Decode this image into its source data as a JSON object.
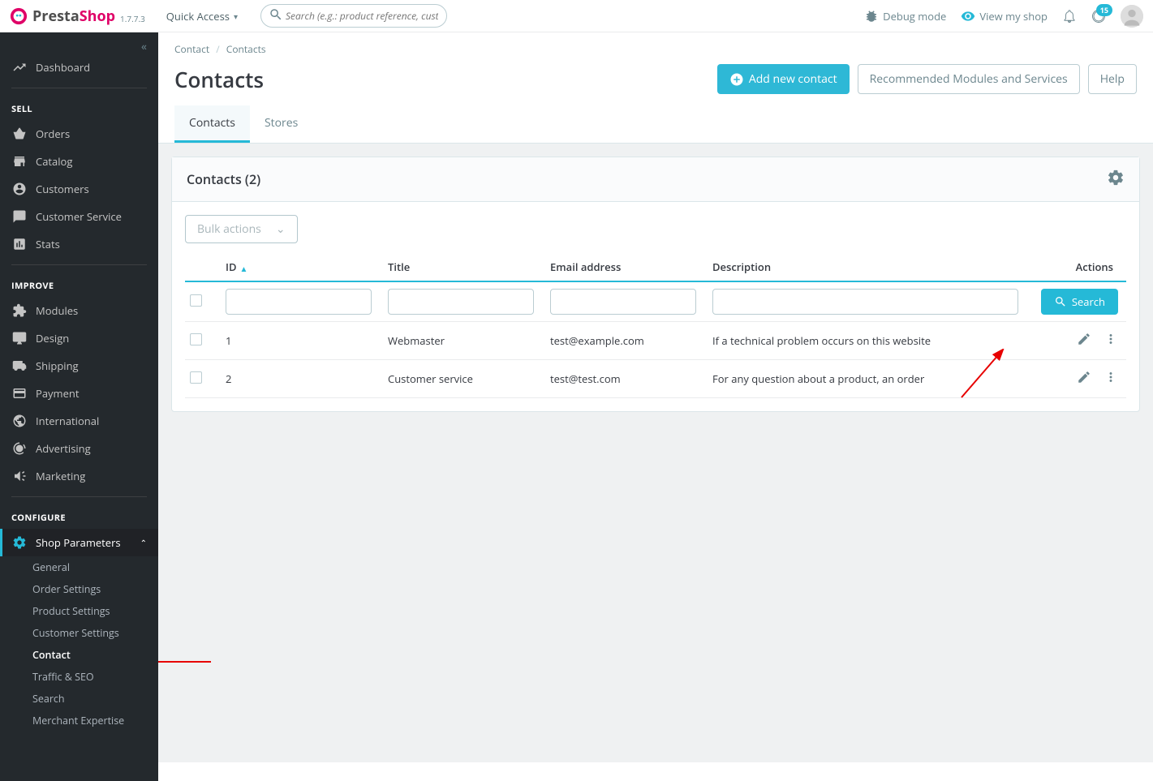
{
  "header": {
    "brand1": "Presta",
    "brand2": "Shop",
    "version": "1.7.7.3",
    "quick_access": "Quick Access",
    "search_placeholder": "Search (e.g.: product reference, customer name…)",
    "debug": "Debug mode",
    "view_shop": "View my shop",
    "notif_count": "15"
  },
  "sidebar": {
    "dashboard": "Dashboard",
    "sell": "SELL",
    "orders": "Orders",
    "catalog": "Catalog",
    "customers": "Customers",
    "customer_service": "Customer Service",
    "stats": "Stats",
    "improve": "IMPROVE",
    "modules": "Modules",
    "design": "Design",
    "shipping": "Shipping",
    "payment": "Payment",
    "international": "International",
    "advertising": "Advertising",
    "marketing": "Marketing",
    "configure": "CONFIGURE",
    "shop_parameters": "Shop Parameters",
    "sub": {
      "general": "General",
      "order_settings": "Order Settings",
      "product_settings": "Product Settings",
      "customer_settings": "Customer Settings",
      "contact": "Contact",
      "traffic_seo": "Traffic & SEO",
      "search": "Search",
      "merchant_expertise": "Merchant Expertise"
    }
  },
  "breadcrumb": {
    "parent": "Contact",
    "current": "Contacts"
  },
  "page": {
    "title": "Contacts",
    "add_btn": "Add new contact",
    "rec_modules": "Recommended Modules and Services",
    "help": "Help"
  },
  "tabs": {
    "contacts": "Contacts",
    "stores": "Stores"
  },
  "card": {
    "title": "Contacts (2)",
    "bulk": "Bulk actions"
  },
  "columns": {
    "id": "ID",
    "title": "Title",
    "email": "Email address",
    "description": "Description",
    "actions": "Actions"
  },
  "filter": {
    "search_btn": "Search"
  },
  "rows": [
    {
      "id": "1",
      "title": "Webmaster",
      "email": "test@example.com",
      "description": "If a technical problem occurs on this website"
    },
    {
      "id": "2",
      "title": "Customer service",
      "email": "test@test.com",
      "description": "For any question about a product, an order"
    }
  ]
}
